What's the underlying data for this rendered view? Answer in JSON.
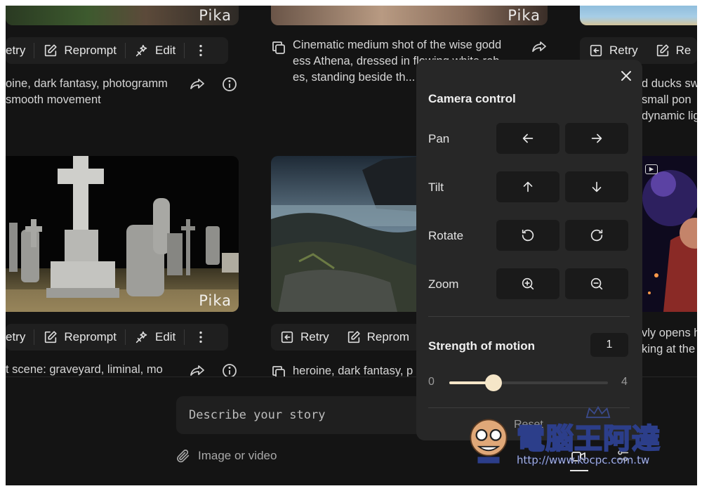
{
  "watermark_brand": "Pika",
  "cards": {
    "top_left": {
      "actions": [
        "etry",
        "Reprompt",
        "Edit"
      ],
      "caption_lines": [
        "oine, dark fantasy, photogramm",
        " smooth movement"
      ]
    },
    "top_middle": {
      "caption_lines": [
        "Cinematic medium shot of the wise godd",
        "ess Athena, dressed in flowing white rob",
        "es, standing beside th..."
      ]
    },
    "top_right": {
      "actions": [
        "Retry",
        "Re"
      ],
      "caption_lines": [
        "d ducks sw",
        " small pon",
        "dynamic lig"
      ]
    },
    "bottom_left": {
      "actions": [
        "etry",
        "Reprompt",
        "Edit"
      ],
      "caption_lines": [
        "t scene: graveyard, liminal, mo"
      ]
    },
    "bottom_middle": {
      "actions": [
        "Retry",
        "Reprom"
      ],
      "caption_lines": [
        "heroine, dark fantasy, p"
      ]
    },
    "bottom_right": {
      "caption_lines": [
        "vly opens h",
        "king at the"
      ]
    }
  },
  "camera_panel": {
    "title": "Camera control",
    "rows": [
      {
        "label": "Pan",
        "buttons": [
          "arrow-left-icon",
          "arrow-right-icon"
        ]
      },
      {
        "label": "Tilt",
        "buttons": [
          "arrow-up-icon",
          "arrow-down-icon"
        ]
      },
      {
        "label": "Rotate",
        "buttons": [
          "rotate-ccw-icon",
          "rotate-cw-icon"
        ]
      },
      {
        "label": "Zoom",
        "buttons": [
          "zoom-in-icon",
          "zoom-out-icon"
        ]
      }
    ],
    "strength_label": "Strength of motion",
    "strength_value": "1",
    "slider": {
      "min": "0",
      "max": "4",
      "value": 1
    },
    "reset_label": "Reset"
  },
  "composer": {
    "placeholder": "Describe your story",
    "attach_label": "Image or video"
  },
  "watermark": {
    "title": "電腦王阿達",
    "url": "http://www.kocpc.com.tw"
  },
  "colors": {
    "background": "#141414",
    "panel": "#272727",
    "button": "#1a1a1a",
    "slider_knob": "#f5e6c8"
  }
}
